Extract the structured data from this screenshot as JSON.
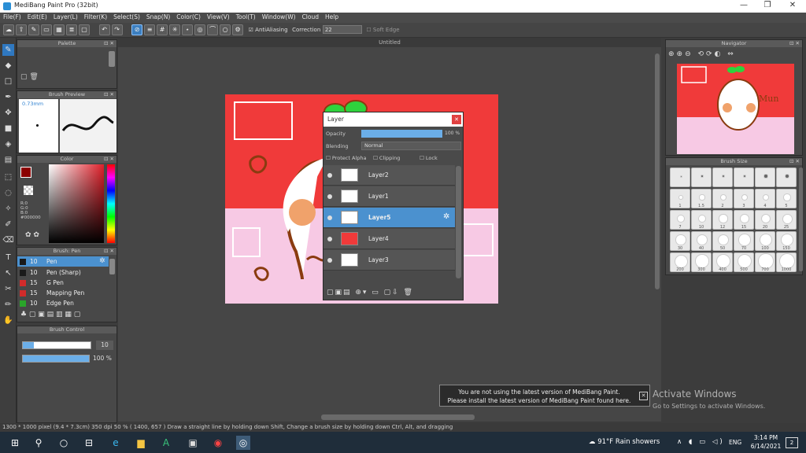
{
  "window": {
    "title": "MediBang Paint Pro (32bit)",
    "min": "—",
    "max": "❐",
    "close": "✕"
  },
  "menu": [
    "File(F)",
    "Edit(E)",
    "Layer(L)",
    "Filter(K)",
    "Select(S)",
    "Snap(N)",
    "Color(C)",
    "View(V)",
    "Tool(T)",
    "Window(W)",
    "Cloud",
    "Help"
  ],
  "toolbar": {
    "antialias_label": "AntiAliasing",
    "correction_label": "Correction",
    "correction_value": "22",
    "softedge_label": "Soft Edge"
  },
  "canvas": {
    "tab_title": "Untitled"
  },
  "panels": {
    "palette": "Palette",
    "brush_preview": "Brush Preview",
    "brush_preview_size": "0.73mm",
    "color": "Color",
    "color_readout": [
      "R:0",
      "G:0",
      "B:0",
      "#000000"
    ],
    "brush_pen": "Brush: Pen",
    "brush_control": "Brush Control",
    "navigator": "Navigator",
    "brush_size": "Brush Size"
  },
  "brushes": [
    {
      "size": "10",
      "name": "Pen",
      "color": "#1a1a1a",
      "selected": true
    },
    {
      "size": "10",
      "name": "Pen (Sharp)",
      "color": "#1a1a1a",
      "selected": false
    },
    {
      "size": "15",
      "name": "G Pen",
      "color": "#d12b2b",
      "selected": false
    },
    {
      "size": "15",
      "name": "Mapping Pen",
      "color": "#d12b2b",
      "selected": false
    },
    {
      "size": "10",
      "name": "Edge Pen",
      "color": "#2aa52a",
      "selected": false
    }
  ],
  "brush_control": {
    "size_value": "10",
    "opacity_value": "100 %"
  },
  "layer_dialog": {
    "title": "Layer",
    "opacity_label": "Opacity",
    "opacity_value": "100 %",
    "blending_label": "Blending",
    "blending_value": "Normal",
    "protect_alpha": "Protect Alpha",
    "clipping": "Clipping",
    "lock": "Lock",
    "layers": [
      {
        "name": "Layer2",
        "selected": false
      },
      {
        "name": "Layer1",
        "selected": false
      },
      {
        "name": "Layer5",
        "selected": true
      },
      {
        "name": "Layer4",
        "selected": false
      },
      {
        "name": "Layer3",
        "selected": false
      }
    ]
  },
  "brush_sizes": [
    "",
    "",
    "",
    "",
    "",
    "",
    "1",
    "1.5",
    "2",
    "3",
    "4",
    "5",
    "7",
    "10",
    "12",
    "15",
    "20",
    "25",
    "30",
    "40",
    "50",
    "70",
    "100",
    "150",
    "200",
    "300",
    "400",
    "500",
    "700",
    "1000"
  ],
  "notification": {
    "line1": "You are not using the latest version of MediBang Paint.",
    "line2": "Please install the latest version of MediBang Paint found here.",
    "close": "✕"
  },
  "activate": {
    "title": "Activate Windows",
    "subtitle": "Go to Settings to activate Windows."
  },
  "status": {
    "text": "1300 * 1000 pixel  (9.4 * 7.3cm)  350 dpi  50 %  ( 1400, 657 )  Draw a straight line by holding down Shift, Change a brush size by holding down Ctrl, Alt, and dragging"
  },
  "taskbar": {
    "weather": "91°F  Rain showers",
    "lang": "ENG",
    "time": "3:14 PM",
    "date": "6/14/2021",
    "badge": "2"
  },
  "art_text": {
    "mun": "Mun"
  }
}
